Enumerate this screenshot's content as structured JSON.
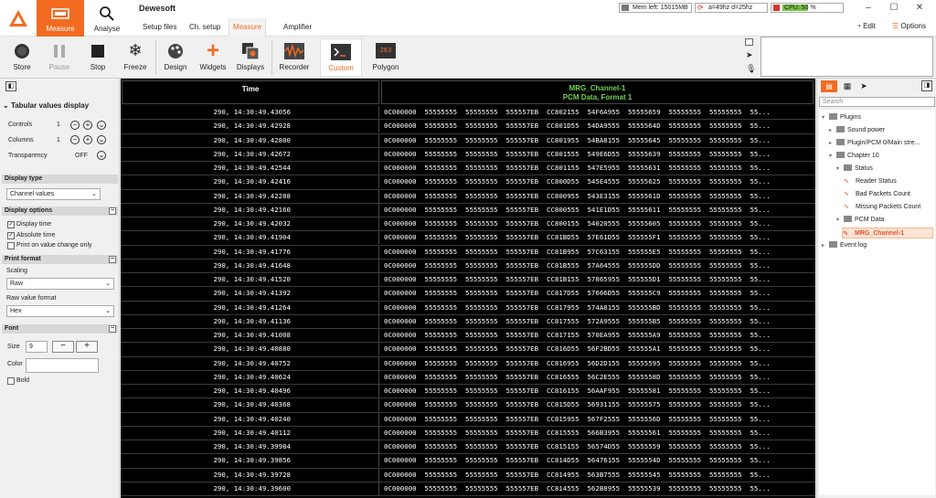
{
  "app": {
    "title": "Dewesoft"
  },
  "modes": {
    "measure": "Measure",
    "analyse": "Analyse"
  },
  "subtabs": [
    "Setup files",
    "Ch. setup",
    "Measure",
    "Amplifier"
  ],
  "status": {
    "mem": "Mem left: 15015MB",
    "rate": "a=49hz d=25hz",
    "cpu": "CPU: 50 %",
    "cpu_percent": 50
  },
  "window": {
    "edit": "Edit",
    "options": "Options"
  },
  "toolbar": {
    "store": "Store",
    "pause": "Pause",
    "stop": "Stop",
    "freeze": "Freeze",
    "design": "Design",
    "widgets": "Widgets",
    "displays": "Displays",
    "recorder": "Recorder",
    "custom": "Custom",
    "polygon": "Polygon",
    "polygon_icon_text": "263"
  },
  "left_panel": {
    "title": "Tabular values display",
    "controls": {
      "label": "Controls",
      "value": "1"
    },
    "columns": {
      "label": "Columns",
      "value": "1"
    },
    "transparency": {
      "label": "Transparency",
      "value": "OFF"
    },
    "display_type": {
      "header": "Display type",
      "value": "Channel values"
    },
    "display_options": {
      "header": "Display options",
      "display_time": "Display time",
      "absolute_time": "Absolute time",
      "print_on_change": "Print on value change only"
    },
    "print_format": {
      "header": "Print format",
      "scaling_label": "Scaling",
      "scaling_value": "Raw",
      "raw_label": "Raw value format",
      "raw_value": "Hex"
    },
    "font": {
      "header": "Font",
      "size_label": "Size",
      "size_value": "9",
      "color_label": "Color",
      "bold_label": "Bold"
    }
  },
  "table": {
    "time_header": "Time",
    "channel_header": "MRG_Channel-1",
    "channel_sub": "PCM Data, Format 1",
    "rows": [
      [
        "290, 14:30:49.43056",
        "0C000000  55555555  55555555  555557EB  CC802155  54F6A955  55555659  55555555  55555555  55..."
      ],
      [
        "290, 14:30:49.42928",
        "0C000000  55555555  55555555  555557EB  CC801D55  54DA9555  5555564D  55555555  55555555  55..."
      ],
      [
        "290, 14:30:49.42800",
        "0C000000  55555555  55555555  555557EB  CC801955  54BA8155  55555645  55555555  55555555  55..."
      ],
      [
        "290, 14:30:49.42672",
        "0C000000  55555555  55555555  555557EB  CC801555  549E6D55  55555639  55555555  55555555  55..."
      ],
      [
        "290, 14:30:49.42544",
        "0C000000  55555555  55555555  555557EB  CC801155  547E5955  55555631  55555555  55555555  55..."
      ],
      [
        "290, 14:30:49.42416",
        "0C000000  55555555  55555555  555557EB  CC800D55  545E4555  55555625  55555555  55555555  55..."
      ],
      [
        "290, 14:30:49.42288",
        "0C000000  55555555  55555555  555557EB  CC800955  543E3155  5555561D  55555555  55555555  55..."
      ],
      [
        "290, 14:30:49.42160",
        "0C000000  55555555  55555555  555557EB  CC800555  541E1D55  55555611  55555555  55555555  55..."
      ],
      [
        "290, 14:30:49.42032",
        "0C000000  55555555  55555555  555557EB  CC800155  54020555  55555605  55555555  55555555  55..."
      ],
      [
        "290, 14:30:49.41904",
        "0C000000  55555555  55555555  555557EB  CC81BD55  57E61D55  555555F1  55555555  55555555  55..."
      ],
      [
        "290, 14:30:49.41776",
        "0C000000  55555555  55555555  555557EB  CC81B955  57C63155  555555E5  55555555  55555555  55..."
      ],
      [
        "290, 14:30:49.41648",
        "0C000000  55555555  55555555  555557EB  CC81B555  57A64555  555555DD  55555555  55555555  55..."
      ],
      [
        "290, 14:30:49.41520",
        "0C000000  55555555  55555555  555557EB  CC81B155  57865955  555555D1  55555555  55555555  55..."
      ],
      [
        "290, 14:30:49.41392",
        "0C000000  55555555  55555555  555557EB  CC817D55  57666D55  555555C9  55555555  55555555  55..."
      ],
      [
        "290, 14:30:49.41264",
        "0C000000  55555555  55555555  555557EB  CC817955  574A8155  555555BD  55555555  55555555  55..."
      ],
      [
        "290, 14:30:49.41136",
        "0C000000  55555555  55555555  555557EB  CC817555  572A9555  555555B5  55555555  55555555  55..."
      ],
      [
        "290, 14:30:49.41008",
        "0C000000  55555555  55555555  555557EB  CC817155  570EA955  555555A9  55555555  55555555  55..."
      ],
      [
        "290, 14:30:49.40880",
        "0C000000  55555555  55555555  555557EB  CC816D55  56F2BD55  555555A1  55555555  55555555  55..."
      ],
      [
        "290, 14:30:49.40752",
        "0C000000  55555555  55555555  555557EB  CC816955  56D2D155  55555595  55555555  55555555  55..."
      ],
      [
        "290, 14:30:49.40624",
        "0C000000  55555555  55555555  555557EB  CC816555  56C2E555  5555558D  55555555  55555555  55..."
      ],
      [
        "290, 14:30:49.40496",
        "0C000000  55555555  55555555  555557EB  CC816155  56AAF955  55555581  55555555  55555555  55..."
      ],
      [
        "290, 14:30:49.40368",
        "0C000000  55555555  55555555  555557EB  CC815D55  56931155  55555575  55555555  55555555  55..."
      ],
      [
        "290, 14:30:49.40240",
        "0C000000  55555555  55555555  555557EB  CC815955  567F2555  5555556D  55555555  55555555  55..."
      ],
      [
        "290, 14:30:49.40112",
        "0C000000  55555555  55555555  555557EB  CC815555  566B3955  55555561  55555555  55555555  55..."
      ],
      [
        "290, 14:30:49.39984",
        "0C000000  55555555  55555555  555557EB  CC815155  56574D55  55555559  55555555  55555555  55..."
      ],
      [
        "290, 14:30:49.39856",
        "0C000000  55555555  55555555  555557EB  CC814D55  56476155  5555554D  55555555  55555555  55..."
      ],
      [
        "290, 14:30:49.39728",
        "0C000000  55555555  55555555  555557EB  CC814955  563B7555  55555545  55555555  55555555  55..."
      ],
      [
        "290, 14:30:49.39600",
        "0C000000  55555555  55555555  555557EB  CC814555  562B8955  55555539  55555555  55555555  55..."
      ]
    ]
  },
  "right_panel": {
    "search_placeholder": "Search",
    "tree": {
      "root": "Plugins",
      "sound_power": "Sound power",
      "plugin_pcm": "Plugin/PCM 0/Main stre...",
      "chapter": "Chapter 10",
      "status": "Status",
      "reader_status": "Reader Status",
      "bad_packets": "Bad Packets Count",
      "missing_packets": "Missing Packets Count",
      "pcm_data": "PCM Data",
      "mrg_channel": "MRG_Channel-1",
      "event_log": "Event log"
    }
  },
  "colors": {
    "accent": "#f26b21",
    "header_green": "#6fd34a",
    "table_bg": "#000000"
  }
}
